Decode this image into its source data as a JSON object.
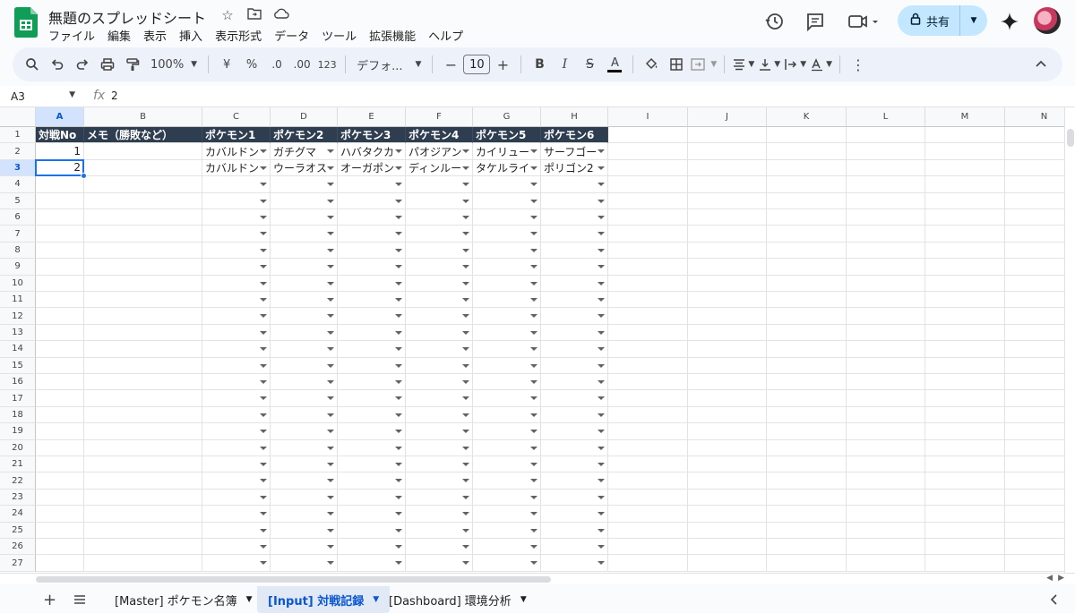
{
  "document": {
    "title": "無題のスプレッドシート"
  },
  "menu": [
    "ファイル",
    "編集",
    "表示",
    "挿入",
    "表示形式",
    "データ",
    "ツール",
    "拡張機能",
    "ヘルプ"
  ],
  "share": {
    "label": "共有"
  },
  "toolbar": {
    "zoom": "100%",
    "currency": "¥",
    "percent": "%",
    "dec_decrease": ".0",
    "dec_increase": ".00",
    "number_format": "123",
    "font": "デフォ...",
    "font_size": "10",
    "minus": "−",
    "plus": "+",
    "bold": "B",
    "italic": "I",
    "strike": "S",
    "text_color": "A",
    "more": "⋮"
  },
  "formula_bar": {
    "cell_ref": "A3",
    "fx": "fx",
    "value": "2"
  },
  "columns": [
    {
      "label": "A",
      "w": 54
    },
    {
      "label": "B",
      "w": 132
    },
    {
      "label": "C",
      "w": 76
    },
    {
      "label": "D",
      "w": 75
    },
    {
      "label": "E",
      "w": 76
    },
    {
      "label": "F",
      "w": 75
    },
    {
      "label": "G",
      "w": 76
    },
    {
      "label": "H",
      "w": 75
    },
    {
      "label": "I",
      "w": 89
    },
    {
      "label": "J",
      "w": 88
    },
    {
      "label": "K",
      "w": 89
    },
    {
      "label": "L",
      "w": 88
    },
    {
      "label": "M",
      "w": 89
    },
    {
      "label": "N",
      "w": 88
    }
  ],
  "header_row": [
    "対戦No",
    "メモ（勝敗など）",
    "ポケモン1",
    "ポケモン2",
    "ポケモン3",
    "ポケモン4",
    "ポケモン5",
    "ポケモン6"
  ],
  "data_rows": [
    [
      "1",
      "",
      "カバルドン",
      "ガチグマ",
      "ハバタクカミ",
      "パオジアン",
      "カイリュー",
      "サーフゴー"
    ],
    [
      "2",
      "",
      "カバルドン",
      "ウーラオス",
      "オーガポン",
      "ディンルー",
      "タケルライコ",
      "ポリゴン2"
    ]
  ],
  "row_count": 27,
  "selected": {
    "row": 3,
    "col": "A"
  },
  "tabs": [
    {
      "label": "[Master] ポケモン名簿",
      "active": false
    },
    {
      "label": "[Input] 対戦記録",
      "active": true
    },
    {
      "label": "[Dashboard] 環境分析",
      "active": false
    }
  ],
  "colors": {
    "header_bg": "#2e3d50",
    "accent": "#1a73e8",
    "share_bg": "#c2e7ff",
    "logo": "#0f9d58"
  }
}
